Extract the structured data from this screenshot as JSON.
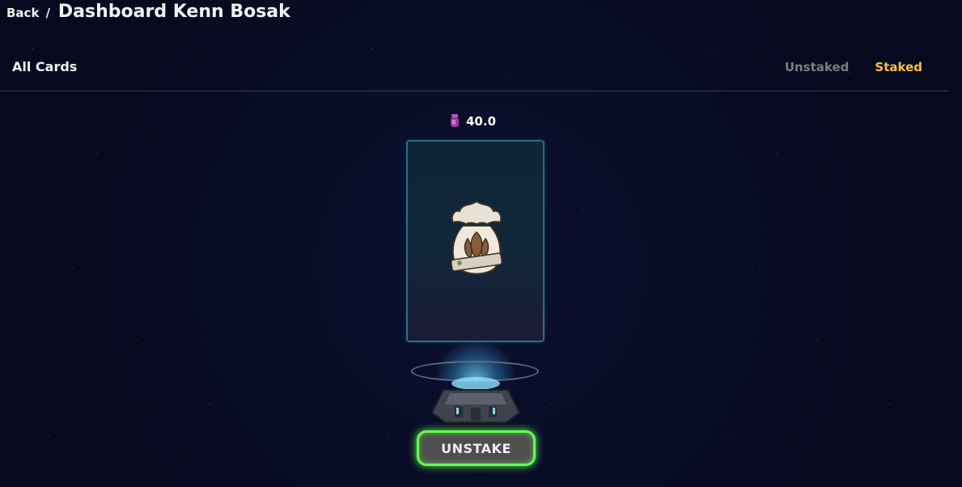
{
  "breadcrumb": {
    "back_label": "Back",
    "separator": "/",
    "title": "Dashboard Kenn Bosak"
  },
  "section": {
    "title": "All Cards",
    "tabs": [
      {
        "label": "Unstaked",
        "active": false
      },
      {
        "label": "Staked",
        "active": true
      }
    ]
  },
  "card": {
    "reward_value": "40.0",
    "reward_icon": "token-icon",
    "art_icon": "money-bag-icon"
  },
  "actions": {
    "unstake_label": "UNSTAKE"
  },
  "colors": {
    "background": "#070a1f",
    "active_tab": "#f5c33b",
    "inactive_tab": "#7d7d7d",
    "button_glow": "#66ff4f"
  }
}
